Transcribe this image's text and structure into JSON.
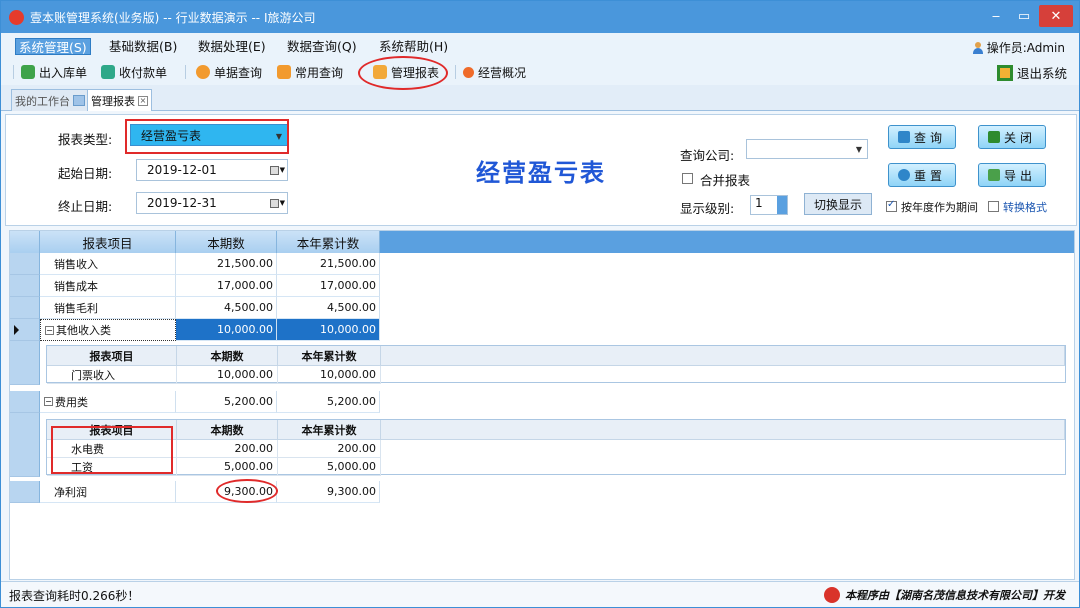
{
  "window": {
    "title": "壹本账管理系统(业务版) -- 行业数据演示 -- I旅游公司",
    "min": "‒",
    "max": "▭",
    "close": "✕"
  },
  "menu": {
    "items": [
      "系统管理(S)",
      "基础数据(B)",
      "数据处理(E)",
      "数据查询(Q)",
      "系统帮助(H)"
    ],
    "operator": "操作员:Admin"
  },
  "toolbar": {
    "buttons": [
      "出入库单",
      "收付款单",
      "单据查询",
      "常用查询",
      "管理报表",
      "经营概况"
    ],
    "exit": "退出系统"
  },
  "tabs": [
    "我的工作台",
    "管理报表"
  ],
  "query": {
    "report_type_label": "报表类型:",
    "report_type_value": "经营盈亏表",
    "start_label": "起始日期:",
    "start_value": "2019-12-01",
    "end_label": "终止日期:",
    "end_value": "2019-12-31",
    "report_title": "经营盈亏表",
    "company_label": "查询公司:",
    "company_value": "",
    "merge_label": "合并报表",
    "level_label": "显示级别:",
    "level_value": "1",
    "switch_label": "切换显示",
    "year_period_label": "按年度作为期间",
    "convert_label": "转换格式",
    "btn_query": "查询",
    "btn_close": "关闭",
    "btn_reset": "重置",
    "btn_export": "导出"
  },
  "grid": {
    "headers": [
      "报表项目",
      "本期数",
      "本年累计数"
    ],
    "rows": [
      {
        "name": "销售收入",
        "current": "21,500.00",
        "ytd": "21,500.00"
      },
      {
        "name": "销售成本",
        "current": "17,000.00",
        "ytd": "17,000.00"
      },
      {
        "name": "销售毛利",
        "current": "4,500.00",
        "ytd": "4,500.00"
      },
      {
        "name": "其他收入类",
        "current": "10,000.00",
        "ytd": "10,000.00"
      },
      {
        "name": "费用类",
        "current": "5,200.00",
        "ytd": "5,200.00"
      },
      {
        "name": "净利润",
        "current": "9,300.00",
        "ytd": "9,300.00"
      }
    ],
    "detail_headers": [
      "报表项目",
      "本期数",
      "本年累计数"
    ],
    "detail_income": [
      {
        "name": "门票收入",
        "current": "10,000.00",
        "ytd": "10,000.00"
      }
    ],
    "detail_expense": [
      {
        "name": "水电费",
        "current": "200.00",
        "ytd": "200.00"
      },
      {
        "name": "工资",
        "current": "5,000.00",
        "ytd": "5,000.00"
      }
    ]
  },
  "status": {
    "text": "报表查询耗时0.266秒！",
    "credit": "本程序由【湖南名茂信息技术有限公司】开发"
  },
  "colors": {
    "accent": "#4a97dc",
    "title_blue": "#2057d6",
    "annotation_red": "#e02a2a"
  }
}
